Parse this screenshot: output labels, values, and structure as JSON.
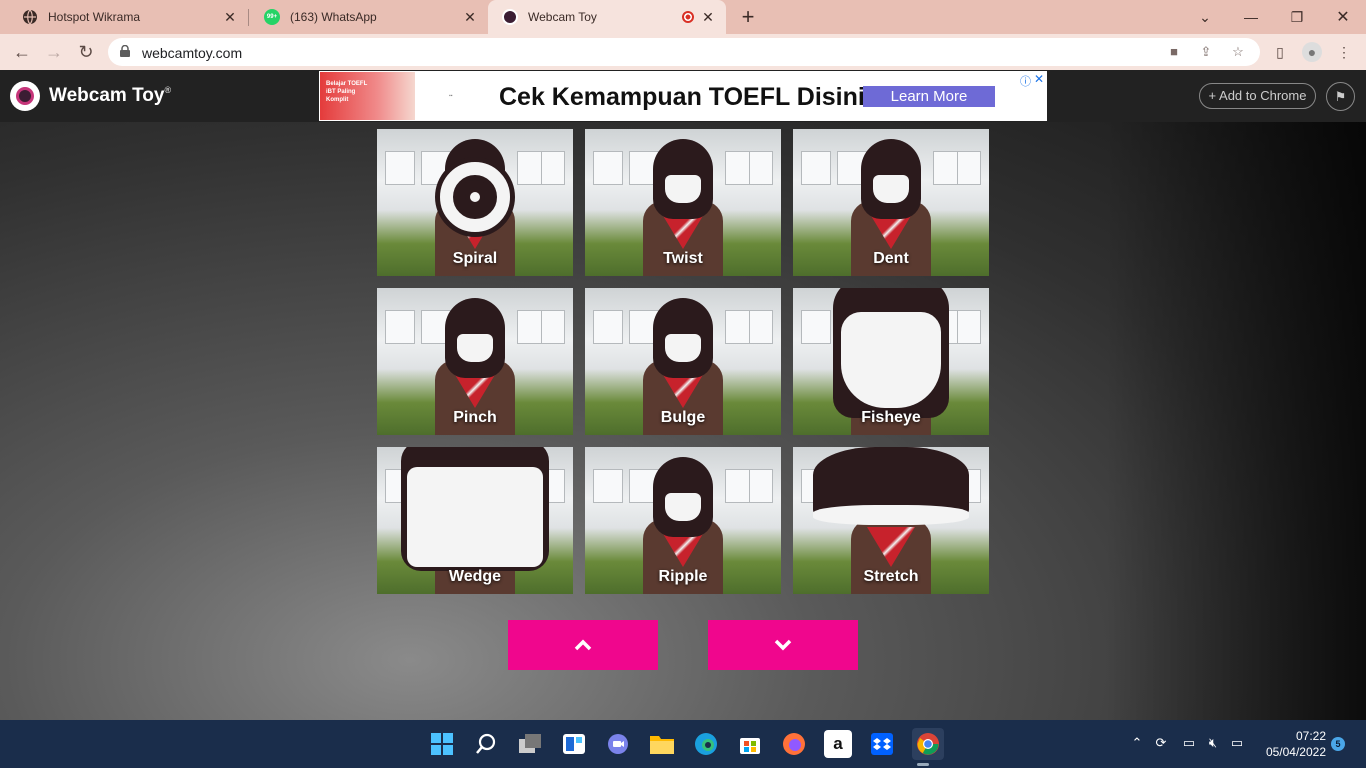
{
  "browser": {
    "tabs": [
      {
        "title": "Hotspot Wikrama",
        "icon": "globe-icon"
      },
      {
        "title": "(163) WhatsApp",
        "icon": "whatsapp-icon",
        "badge": "99+"
      },
      {
        "title": "Webcam Toy",
        "icon": "webcamtoy-icon",
        "active": true,
        "recording": true
      }
    ],
    "url": "webcamtoy.com"
  },
  "site": {
    "name": "Webcam Toy",
    "reg_mark": "®",
    "add_to_chrome": "+ Add to Chrome"
  },
  "ad": {
    "thumb_text": "Belajar TOEFL iBT Paling Komplit",
    "headline": "Cek Kemampuan TOEFL Disini",
    "cta": "Learn More"
  },
  "effects": [
    "Spiral",
    "Twist",
    "Dent",
    "Pinch",
    "Bulge",
    "Fisheye",
    "Wedge",
    "Ripple",
    "Stretch"
  ],
  "nav": {
    "up_icon": "chevron-up-icon",
    "down_icon": "chevron-down-icon"
  },
  "taskbar": {
    "time": "07:22",
    "date": "05/04/2022",
    "notifications": "5",
    "apps": [
      "start",
      "search",
      "task-view",
      "widgets",
      "teams-chat",
      "file-explorer",
      "edge",
      "store",
      "firefox",
      "amazon",
      "dropbox",
      "chrome"
    ]
  },
  "colors": {
    "accent": "#f0068d",
    "tabstrip": "#e8bfb4",
    "taskbar": "#1a2d4b"
  }
}
